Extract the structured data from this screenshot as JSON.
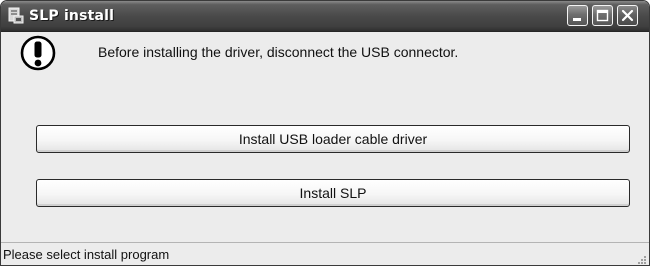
{
  "window": {
    "title": "SLP install",
    "app_icon": "installer-icon",
    "controls": {
      "minimize": "minimize-icon",
      "maximize": "maximize-icon",
      "close": "close-icon"
    }
  },
  "main": {
    "warning_icon": "exclamation-icon",
    "message": "Before installing the driver, disconnect the USB connector.",
    "buttons": {
      "usb_driver_label": "Install USB loader cable driver",
      "slp_label": "Install SLP"
    }
  },
  "statusbar": {
    "text": "Please select install program"
  },
  "colors": {
    "titlebar": "#4a4a4a",
    "client_background": "#ececec",
    "title_text": "#ffffff"
  }
}
